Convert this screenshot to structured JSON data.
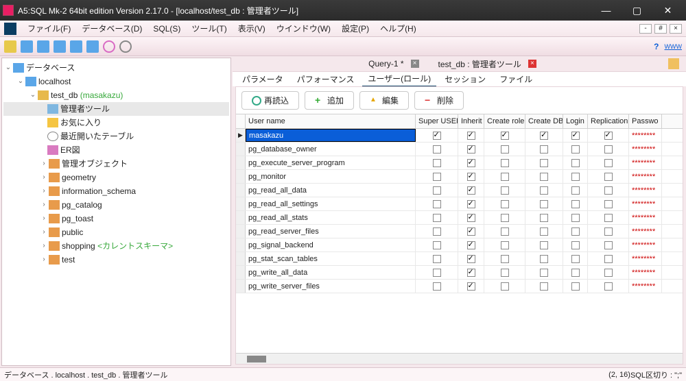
{
  "title": "A5:SQL Mk-2 64bit edition Version 2.17.0 - [localhost/test_db : 管理者ツール]",
  "menu": {
    "file": "ファイル(F)",
    "database": "データベース(D)",
    "sql": "SQL(S)",
    "tool": "ツール(T)",
    "view": "表示(V)",
    "window": "ウインドウ(W)",
    "setting": "設定(P)",
    "help": "ヘルプ(H)"
  },
  "tabs": {
    "t1": "Query-1 *",
    "t2": "test_db : 管理者ツール"
  },
  "subtabs": {
    "param": "パラメータ",
    "perf": "パフォーマンス",
    "user": "ユーザー(ロール)",
    "session": "セッション",
    "file": "ファイル"
  },
  "buttons": {
    "reload": "再読込",
    "add": "追加",
    "edit": "編集",
    "del": "削除"
  },
  "cols": {
    "name": "User name",
    "super": "Super USER",
    "inherit": "Inherit",
    "createrole": "Create role",
    "createdb": "Create DB",
    "login": "Login",
    "repl": "Replication",
    "pass": "Passwo"
  },
  "tree": {
    "root": "データベース",
    "host": "localhost",
    "db": "test_db",
    "owner": "(masakazu)",
    "admin": "管理者ツール",
    "fav": "お気に入り",
    "recent": "最近開いたテーブル",
    "er": "ER図",
    "mng": "管理オブジェクト",
    "geo": "geometry",
    "info": "information_schema",
    "cat": "pg_catalog",
    "toast": "pg_toast",
    "pub": "public",
    "shop": "shopping",
    "cur": "<カレントスキーマ>",
    "test": "test"
  },
  "rows": [
    {
      "name": "masakazu",
      "s": true,
      "i": true,
      "cr": true,
      "cd": true,
      "l": true,
      "r": true,
      "pw": "********"
    },
    {
      "name": "pg_database_owner",
      "s": false,
      "i": true,
      "cr": false,
      "cd": false,
      "l": false,
      "r": false,
      "pw": "********"
    },
    {
      "name": "pg_execute_server_program",
      "s": false,
      "i": true,
      "cr": false,
      "cd": false,
      "l": false,
      "r": false,
      "pw": "********"
    },
    {
      "name": "pg_monitor",
      "s": false,
      "i": true,
      "cr": false,
      "cd": false,
      "l": false,
      "r": false,
      "pw": "********"
    },
    {
      "name": "pg_read_all_data",
      "s": false,
      "i": true,
      "cr": false,
      "cd": false,
      "l": false,
      "r": false,
      "pw": "********"
    },
    {
      "name": "pg_read_all_settings",
      "s": false,
      "i": true,
      "cr": false,
      "cd": false,
      "l": false,
      "r": false,
      "pw": "********"
    },
    {
      "name": "pg_read_all_stats",
      "s": false,
      "i": true,
      "cr": false,
      "cd": false,
      "l": false,
      "r": false,
      "pw": "********"
    },
    {
      "name": "pg_read_server_files",
      "s": false,
      "i": true,
      "cr": false,
      "cd": false,
      "l": false,
      "r": false,
      "pw": "********"
    },
    {
      "name": "pg_signal_backend",
      "s": false,
      "i": true,
      "cr": false,
      "cd": false,
      "l": false,
      "r": false,
      "pw": "********"
    },
    {
      "name": "pg_stat_scan_tables",
      "s": false,
      "i": true,
      "cr": false,
      "cd": false,
      "l": false,
      "r": false,
      "pw": "********"
    },
    {
      "name": "pg_write_all_data",
      "s": false,
      "i": true,
      "cr": false,
      "cd": false,
      "l": false,
      "r": false,
      "pw": "********"
    },
    {
      "name": "pg_write_server_files",
      "s": false,
      "i": true,
      "cr": false,
      "cd": false,
      "l": false,
      "r": false,
      "pw": "********"
    }
  ],
  "status": {
    "path": "データベース . localhost . test_db . 管理者ツール",
    "pos": "(2, 16)",
    "sep": "SQL区切り : \";\""
  }
}
